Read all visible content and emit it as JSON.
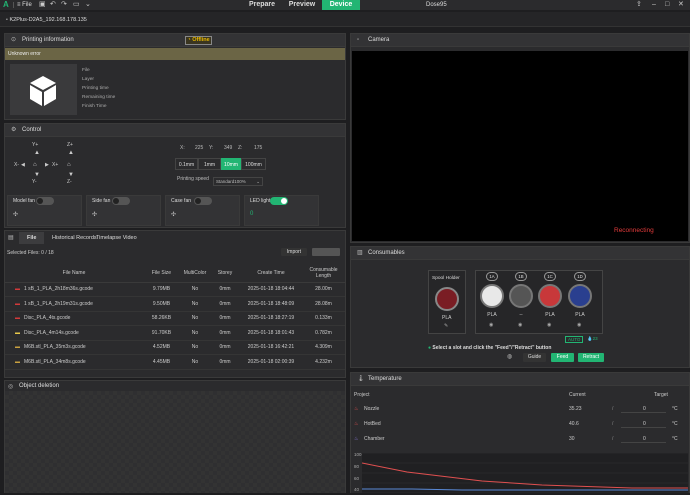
{
  "app": {
    "logo": "A",
    "file_menu": "File",
    "nav_tabs": [
      "Prepare",
      "Preview",
      "Device"
    ],
    "active_tab": "Device",
    "project_name": "Dose95",
    "accent_color": "#22b573"
  },
  "device_tab": {
    "label": "K2Plus-D2A5_192.168.178.135"
  },
  "printing_info": {
    "title": "Printing information",
    "status": "Offline",
    "error": "Unknown error",
    "fields": [
      "File",
      "Layer",
      "Printing time",
      "Remaining time",
      "Finish Time"
    ]
  },
  "control": {
    "title": "Control",
    "y_plus": "Y+",
    "y_minus": "Y-",
    "x_minus": "X-",
    "x_plus": "X+",
    "z_plus": "Z+",
    "z_minus": "Z-",
    "coords": {
      "x_label": "X:",
      "x": "225",
      "y_label": "Y:",
      "y": "349",
      "z_label": "Z:",
      "z": "175"
    },
    "steps": [
      "0.1mm",
      "1mm",
      "10mm",
      "100mm"
    ],
    "active_step": "10mm",
    "speed_label": "Printing speed",
    "speed_value": "Standard100%",
    "fans": [
      {
        "label": "Model fan",
        "on": false
      },
      {
        "label": "Side fan",
        "on": false
      },
      {
        "label": "Case fan",
        "on": false
      },
      {
        "label": "LED light",
        "on": true,
        "value": "0"
      }
    ]
  },
  "files": {
    "tabs": [
      "File",
      "Historical Records",
      "Timelapse Video"
    ],
    "active_tab": "File",
    "selected": "Selected Files: 0 / 18",
    "import_label": "Import",
    "headers": [
      "File Name",
      "File Size",
      "MultiColor",
      "Storey",
      "Create Time",
      "Consumable Length"
    ],
    "rows": [
      {
        "name": "1 sB_1_PLA_2h18m36s.gcode",
        "size": "9.79MB",
        "multi": "No",
        "storey": "0mm",
        "time": "2025-01-18 18:04:44",
        "length": "28.00m",
        "color": "#d23a3a"
      },
      {
        "name": "1 sB_1_PLA_2h19m31s.gcode",
        "size": "9.50MB",
        "multi": "No",
        "storey": "0mm",
        "time": "2025-01-18 18:48:09",
        "length": "28.08m",
        "color": "#d23a3a"
      },
      {
        "name": "Disc_PLA_4ts.gcode",
        "size": "58.26KB",
        "multi": "No",
        "storey": "0mm",
        "time": "2025-01-18 18:27:19",
        "length": "0.133m",
        "color": "#d23a3a"
      },
      {
        "name": "Disc_PLA_4m14s.gcode",
        "size": "91.70KB",
        "multi": "No",
        "storey": "0mm",
        "time": "2025-01-18 18:01:43",
        "length": "0.782m",
        "color": "#e8c84a"
      },
      {
        "name": "M6B.stl_PLA_35m3s.gcode",
        "size": "4.52MB",
        "multi": "No",
        "storey": "0mm",
        "time": "2025-01-18 16:42:21",
        "length": "4.309m",
        "color": "#c8a040"
      },
      {
        "name": "M6B.stl_PLA_34m8s.gcode",
        "size": "4.45MB",
        "multi": "No",
        "storey": "0mm",
        "time": "2025-01-18 02:00:39",
        "length": "4.232m",
        "color": "#c8a040"
      }
    ]
  },
  "object_deletion": {
    "title": "Object deletion"
  },
  "camera": {
    "title": "Camera",
    "status": "Reconnecting"
  },
  "consumables": {
    "title": "Consumables",
    "spool_holder": "Spool Holder",
    "slots": [
      {
        "num": "",
        "material": "PLA",
        "color": "#7a1d24"
      },
      {
        "num": "1A",
        "material": "PLA",
        "color": "#e8e8e8"
      },
      {
        "num": "1B",
        "material": "--",
        "color": "#555555"
      },
      {
        "num": "1C",
        "material": "PLA",
        "color": "#c8383a"
      },
      {
        "num": "1D",
        "material": "PLA",
        "color": "#2a3f8f"
      }
    ],
    "auto_label": "AUTO",
    "humidity": "23",
    "hint": "Select a slot and click the \"Feed\"/\"Retract\" button",
    "guide": "Guide",
    "feed": "Feed",
    "retract": "Retract"
  },
  "temperature": {
    "title": "Temperature",
    "headers": [
      "Project",
      "Current",
      "Target"
    ],
    "rows": [
      {
        "name": "Nozzle",
        "current": "35.23",
        "target": "0",
        "unit": "°C",
        "color": "#e05050"
      },
      {
        "name": "HotBed",
        "current": "40.6",
        "target": "0",
        "unit": "°C",
        "color": "#e05050"
      },
      {
        "name": "Chamber",
        "current": "30",
        "target": "0",
        "unit": "°C",
        "color": "#8a7ad8"
      }
    ],
    "y_ticks": [
      "100",
      "80",
      "60",
      "40"
    ]
  }
}
